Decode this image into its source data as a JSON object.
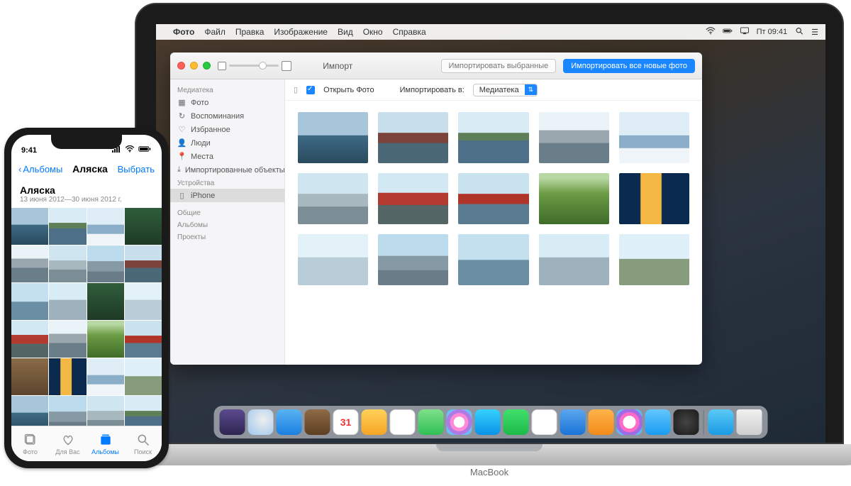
{
  "mac": {
    "menubar": {
      "app": "Фото",
      "items": [
        "Файл",
        "Правка",
        "Изображение",
        "Вид",
        "Окно",
        "Справка"
      ],
      "clock": "Пт 09:41"
    },
    "window": {
      "title": "Импорт",
      "btn_selected": "Импортировать выбранные",
      "btn_all": "Импортировать все новые фото",
      "subbar": {
        "open": "Открыть Фото",
        "import_to": "Импортировать в:",
        "dest": "Медиатека"
      }
    },
    "sidebar": {
      "h1": "Медиатека",
      "items1": [
        "Фото",
        "Воспоминания",
        "Избранное",
        "Люди",
        "Места",
        "Импортированные объекты"
      ],
      "h2": "Устройства",
      "device": "iPhone",
      "extra": [
        "Общие",
        "Альбомы",
        "Проекты"
      ]
    },
    "logo": "MacBook"
  },
  "iphone": {
    "status_time": "9:41",
    "back": "Альбомы",
    "title": "Аляска",
    "select": "Выбрать",
    "album": {
      "name": "Аляска",
      "dates": "13 июня 2012—30 июня 2012 г."
    },
    "tabs": [
      "Фото",
      "Для Вас",
      "Альбомы",
      "Поиск"
    ]
  }
}
